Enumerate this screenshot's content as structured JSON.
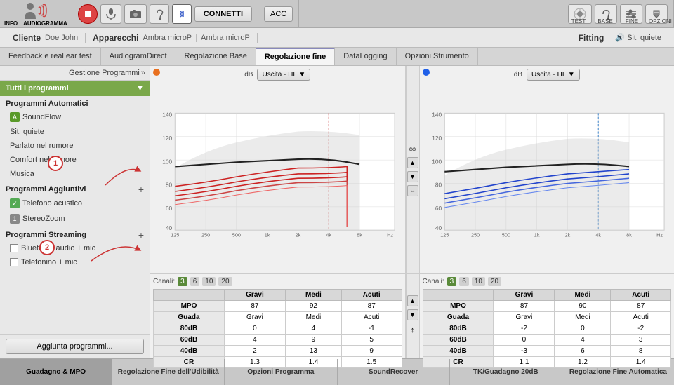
{
  "toolbar": {
    "info_label": "INFO",
    "audiogramma_label": "AUDIOGRAMMA",
    "connetti_label": "CONNETTI",
    "acc_label": "ACC",
    "test_label": "TEST",
    "base_label": "BASE",
    "fine_label": "FINE",
    "opzioni_label": "OPZIONI"
  },
  "header": {
    "cliente_label": "Cliente",
    "cliente_value": "Doe John",
    "apparecchi_label": "Apparecchi",
    "apparecchi_value1": "Ambra microP",
    "apparecchi_value2": "Ambra microP",
    "fitting_label": "Fitting",
    "sit_quiete_label": "Sit. quiete"
  },
  "tabs": [
    {
      "id": "feedback",
      "label": "Feedback e real ear test"
    },
    {
      "id": "audiogramdirect",
      "label": "AudiogramDirect"
    },
    {
      "id": "regolazione_base",
      "label": "Regolazione Base"
    },
    {
      "id": "regolazione_fine",
      "label": "Regolazione fine",
      "active": true
    },
    {
      "id": "datalogging",
      "label": "DataLogging"
    },
    {
      "id": "opzioni_strumento",
      "label": "Opzioni Strumento"
    }
  ],
  "sidebar": {
    "gestione_label": "Gestione Programmi",
    "tutti_programmi_label": "Tutti i programmi",
    "programmi_automatici_label": "Programmi Automatici",
    "programs_auto": [
      {
        "letter": "A",
        "label": "SoundFlow",
        "active": false
      },
      {
        "label": "Sit. quiete",
        "active": false
      },
      {
        "label": "Parlato nel rumore",
        "active": false
      },
      {
        "label": "Comfort nel rumore",
        "active": false
      },
      {
        "label": "Musica",
        "active": false
      }
    ],
    "programmi_aggiuntivi_label": "Programmi Aggiuntivi",
    "programs_add": [
      {
        "letter": "✓",
        "label": "Telefono acustico",
        "active": false
      },
      {
        "letter": "1",
        "label": "StereoZoom",
        "active": false
      }
    ],
    "programmi_streaming_label": "Programmi Streaming",
    "programs_stream": [
      {
        "label": "Bluetooth audio + mic"
      },
      {
        "label": "Telefonino + mic"
      }
    ],
    "aggiunta_label": "Aggiunta programmi..."
  },
  "charts": {
    "left": {
      "indicator_color": "#e87020",
      "db_label": "dB",
      "y_values": [
        "140",
        "120",
        "100",
        "80",
        "60",
        "40"
      ],
      "x_values": [
        "125",
        "250",
        "500",
        "1k",
        "2k",
        "4k",
        "8k",
        "Hz"
      ],
      "uscita_label": "Uscita - HL",
      "channels_label": "Canali:",
      "channels": [
        "3",
        "6",
        "10",
        "20"
      ],
      "active_channel": "3",
      "table": {
        "headers": [
          "",
          "Gravi",
          "Medi",
          "Acuti"
        ],
        "rows": [
          {
            "label": "MPO",
            "gravi": "87",
            "medi": "92",
            "acuti": "87"
          },
          {
            "label": "Guada",
            "gravi": "",
            "medi": "",
            "acuti": ""
          },
          {
            "label": "80dB",
            "gravi": "0",
            "medi": "4",
            "acuti": "-1"
          },
          {
            "label": "60dB",
            "gravi": "4",
            "medi": "9",
            "acuti": "5"
          },
          {
            "label": "40dB",
            "gravi": "2",
            "medi": "13",
            "acuti": "9"
          },
          {
            "label": "CR",
            "gravi": "1.3",
            "medi": "1.4",
            "acuti": "1.5"
          }
        ]
      }
    },
    "right": {
      "indicator_color": "#2060e8",
      "db_label": "dB",
      "y_values": [
        "140",
        "120",
        "100",
        "80",
        "60",
        "40"
      ],
      "x_values": [
        "125",
        "250",
        "500",
        "1k",
        "2k",
        "4k",
        "8k",
        "Hz"
      ],
      "uscita_label": "Uscita - HL",
      "channels_label": "Canali:",
      "channels": [
        "3",
        "6",
        "10",
        "20"
      ],
      "active_channel": "3",
      "table": {
        "headers": [
          "",
          "Gravi",
          "Medi",
          "Acuti"
        ],
        "rows": [
          {
            "label": "MPO",
            "gravi": "87",
            "medi": "90",
            "acuti": "87"
          },
          {
            "label": "Guada",
            "gravi": "",
            "medi": "",
            "acuti": ""
          },
          {
            "label": "80dB",
            "gravi": "-2",
            "medi": "0",
            "acuti": "-2"
          },
          {
            "label": "60dB",
            "gravi": "0",
            "medi": "4",
            "acuti": "3"
          },
          {
            "label": "40dB",
            "gravi": "-3",
            "medi": "6",
            "acuti": "8"
          },
          {
            "label": "CR",
            "gravi": "1.1",
            "medi": "1.2",
            "acuti": "1.4"
          }
        ]
      }
    }
  },
  "bottom_tabs": [
    {
      "label": "Guadagno & MPO",
      "active": true
    },
    {
      "label": "Regolazione Fine dell'Udibilità",
      "active": false
    },
    {
      "label": "Opzioni Programma",
      "active": false
    },
    {
      "label": "SoundRecover",
      "active": false
    },
    {
      "label": "TK/Guadagno 20dB",
      "active": false
    },
    {
      "label": "Regolazione Fine Automatica",
      "active": false
    }
  ],
  "annotations": {
    "circle1_label": "1",
    "circle2_label": "2"
  }
}
